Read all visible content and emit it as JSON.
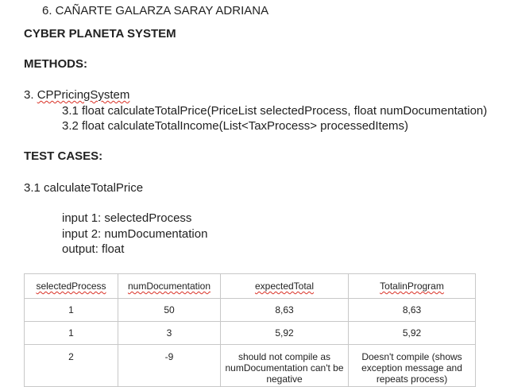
{
  "author_line": "6.   CAÑARTE GALARZA SARAY ADRIANA",
  "system_title": "CYBER PLANETA SYSTEM",
  "methods_heading": "METHODS:",
  "class_number": "3. ",
  "class_name": "CPPricingSystem",
  "methods": [
    "3.1 float calculateTotalPrice(PriceList selectedProcess, float numDocumentation)",
    "3.2 float calculateTotalIncome(List<TaxProcess> processedItems)"
  ],
  "test_cases_heading": "TEST CASES:",
  "case_title": "3.1 calculateTotalPrice",
  "io": [
    "input 1: selectedProcess",
    "input 2: numDocumentation",
    "output: float"
  ],
  "table": {
    "headers": [
      "selectedProcess",
      "numDocumentation",
      "expectedTotal",
      "TotalinProgram"
    ],
    "rows": [
      [
        "1",
        "50",
        "8,63",
        "8,63"
      ],
      [
        "1",
        "3",
        "5,92",
        "5,92"
      ],
      [
        "2",
        "-9",
        "should not compile as numDocumentation can't be negative",
        "Doesn't compile (shows exception message and repeats process)"
      ]
    ]
  }
}
